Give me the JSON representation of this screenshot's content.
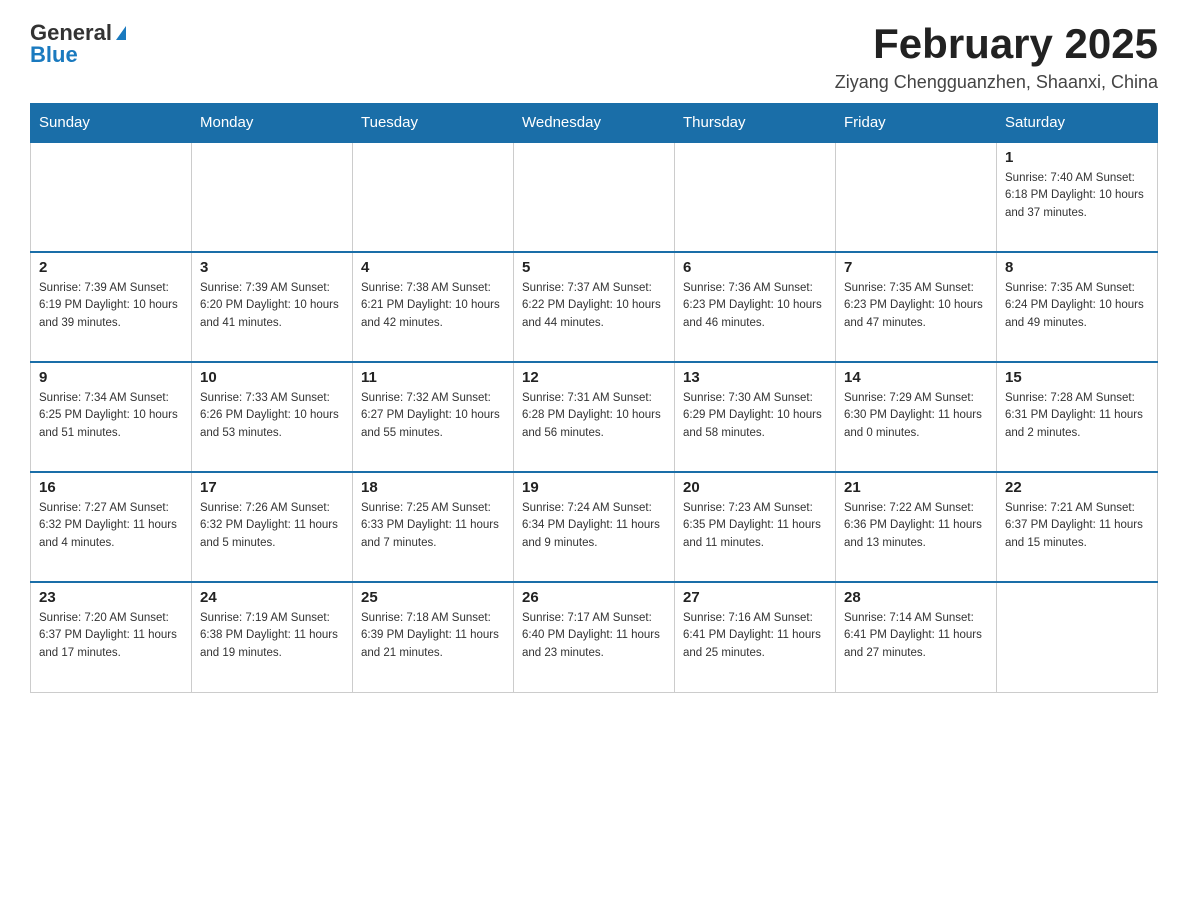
{
  "logo": {
    "general": "General",
    "blue": "Blue"
  },
  "title": "February 2025",
  "location": "Ziyang Chengguanzhen, Shaanxi, China",
  "days_of_week": [
    "Sunday",
    "Monday",
    "Tuesday",
    "Wednesday",
    "Thursday",
    "Friday",
    "Saturday"
  ],
  "weeks": [
    [
      {
        "day": "",
        "info": ""
      },
      {
        "day": "",
        "info": ""
      },
      {
        "day": "",
        "info": ""
      },
      {
        "day": "",
        "info": ""
      },
      {
        "day": "",
        "info": ""
      },
      {
        "day": "",
        "info": ""
      },
      {
        "day": "1",
        "info": "Sunrise: 7:40 AM\nSunset: 6:18 PM\nDaylight: 10 hours and 37 minutes."
      }
    ],
    [
      {
        "day": "2",
        "info": "Sunrise: 7:39 AM\nSunset: 6:19 PM\nDaylight: 10 hours and 39 minutes."
      },
      {
        "day": "3",
        "info": "Sunrise: 7:39 AM\nSunset: 6:20 PM\nDaylight: 10 hours and 41 minutes."
      },
      {
        "day": "4",
        "info": "Sunrise: 7:38 AM\nSunset: 6:21 PM\nDaylight: 10 hours and 42 minutes."
      },
      {
        "day": "5",
        "info": "Sunrise: 7:37 AM\nSunset: 6:22 PM\nDaylight: 10 hours and 44 minutes."
      },
      {
        "day": "6",
        "info": "Sunrise: 7:36 AM\nSunset: 6:23 PM\nDaylight: 10 hours and 46 minutes."
      },
      {
        "day": "7",
        "info": "Sunrise: 7:35 AM\nSunset: 6:23 PM\nDaylight: 10 hours and 47 minutes."
      },
      {
        "day": "8",
        "info": "Sunrise: 7:35 AM\nSunset: 6:24 PM\nDaylight: 10 hours and 49 minutes."
      }
    ],
    [
      {
        "day": "9",
        "info": "Sunrise: 7:34 AM\nSunset: 6:25 PM\nDaylight: 10 hours and 51 minutes."
      },
      {
        "day": "10",
        "info": "Sunrise: 7:33 AM\nSunset: 6:26 PM\nDaylight: 10 hours and 53 minutes."
      },
      {
        "day": "11",
        "info": "Sunrise: 7:32 AM\nSunset: 6:27 PM\nDaylight: 10 hours and 55 minutes."
      },
      {
        "day": "12",
        "info": "Sunrise: 7:31 AM\nSunset: 6:28 PM\nDaylight: 10 hours and 56 minutes."
      },
      {
        "day": "13",
        "info": "Sunrise: 7:30 AM\nSunset: 6:29 PM\nDaylight: 10 hours and 58 minutes."
      },
      {
        "day": "14",
        "info": "Sunrise: 7:29 AM\nSunset: 6:30 PM\nDaylight: 11 hours and 0 minutes."
      },
      {
        "day": "15",
        "info": "Sunrise: 7:28 AM\nSunset: 6:31 PM\nDaylight: 11 hours and 2 minutes."
      }
    ],
    [
      {
        "day": "16",
        "info": "Sunrise: 7:27 AM\nSunset: 6:32 PM\nDaylight: 11 hours and 4 minutes."
      },
      {
        "day": "17",
        "info": "Sunrise: 7:26 AM\nSunset: 6:32 PM\nDaylight: 11 hours and 5 minutes."
      },
      {
        "day": "18",
        "info": "Sunrise: 7:25 AM\nSunset: 6:33 PM\nDaylight: 11 hours and 7 minutes."
      },
      {
        "day": "19",
        "info": "Sunrise: 7:24 AM\nSunset: 6:34 PM\nDaylight: 11 hours and 9 minutes."
      },
      {
        "day": "20",
        "info": "Sunrise: 7:23 AM\nSunset: 6:35 PM\nDaylight: 11 hours and 11 minutes."
      },
      {
        "day": "21",
        "info": "Sunrise: 7:22 AM\nSunset: 6:36 PM\nDaylight: 11 hours and 13 minutes."
      },
      {
        "day": "22",
        "info": "Sunrise: 7:21 AM\nSunset: 6:37 PM\nDaylight: 11 hours and 15 minutes."
      }
    ],
    [
      {
        "day": "23",
        "info": "Sunrise: 7:20 AM\nSunset: 6:37 PM\nDaylight: 11 hours and 17 minutes."
      },
      {
        "day": "24",
        "info": "Sunrise: 7:19 AM\nSunset: 6:38 PM\nDaylight: 11 hours and 19 minutes."
      },
      {
        "day": "25",
        "info": "Sunrise: 7:18 AM\nSunset: 6:39 PM\nDaylight: 11 hours and 21 minutes."
      },
      {
        "day": "26",
        "info": "Sunrise: 7:17 AM\nSunset: 6:40 PM\nDaylight: 11 hours and 23 minutes."
      },
      {
        "day": "27",
        "info": "Sunrise: 7:16 AM\nSunset: 6:41 PM\nDaylight: 11 hours and 25 minutes."
      },
      {
        "day": "28",
        "info": "Sunrise: 7:14 AM\nSunset: 6:41 PM\nDaylight: 11 hours and 27 minutes."
      },
      {
        "day": "",
        "info": ""
      }
    ]
  ]
}
